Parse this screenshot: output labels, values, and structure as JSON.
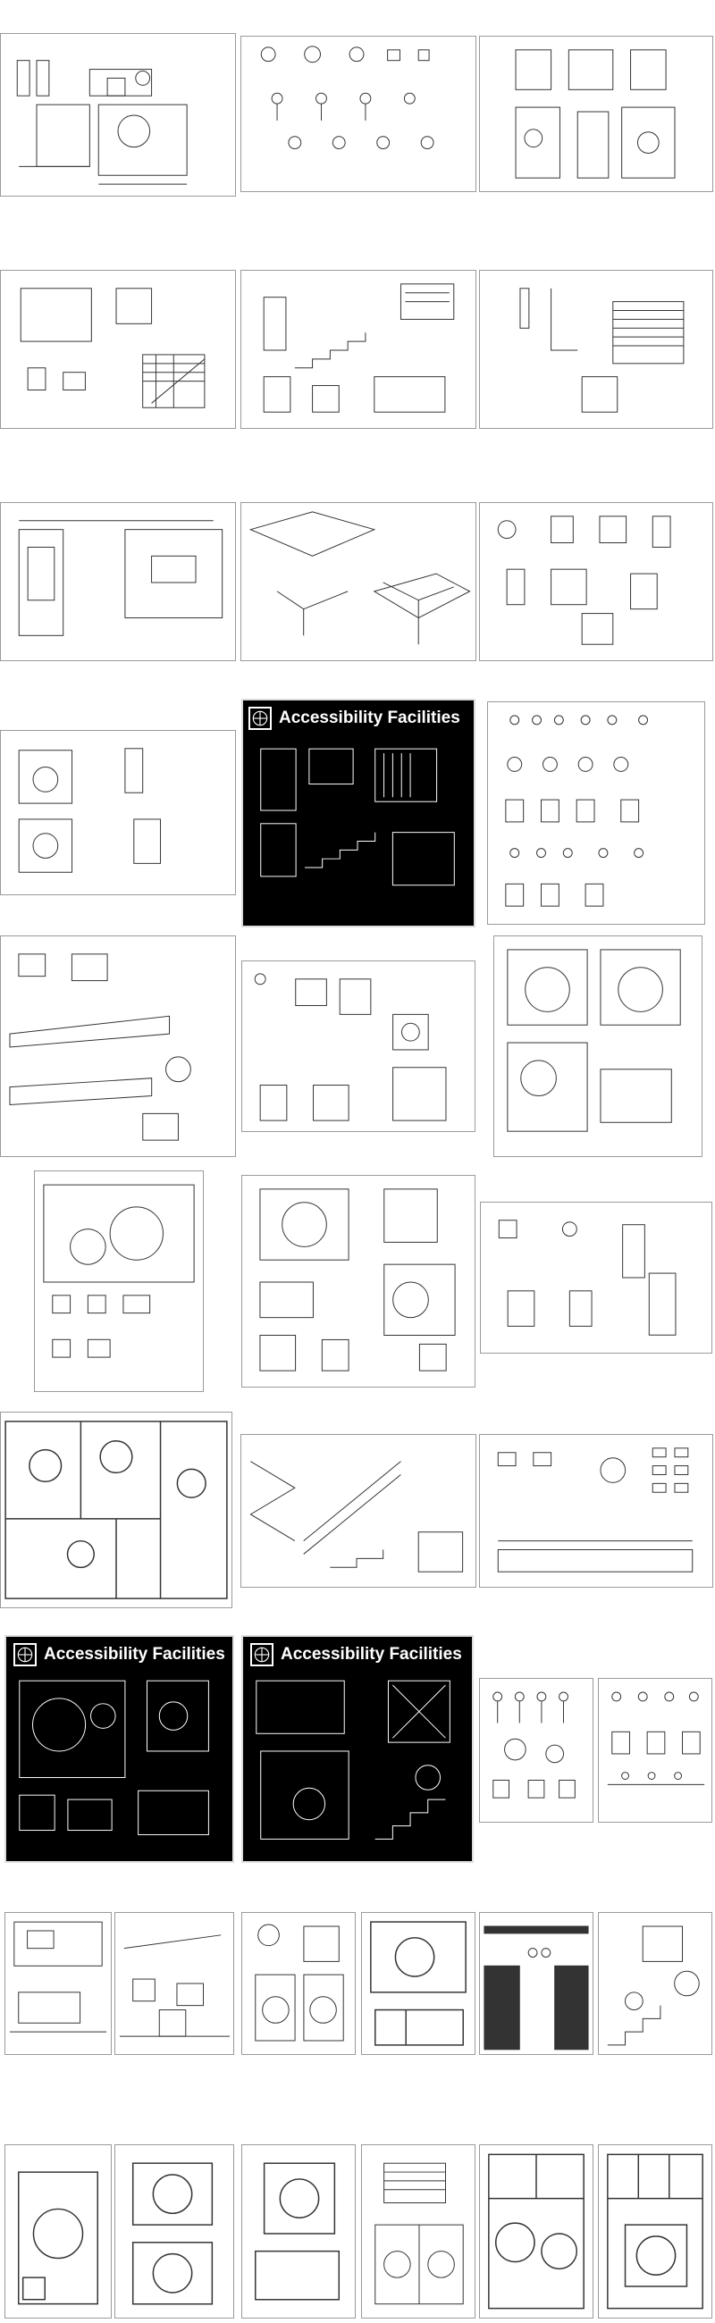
{
  "page": {
    "banner_title": "Accessibility Facilities",
    "icons": [
      "vitruvian-logo-icon"
    ]
  },
  "rows": [
    [
      "sheet-1",
      "sheet-2",
      "sheet-3"
    ],
    [
      "sheet-4",
      "sheet-5",
      "sheet-6"
    ],
    [
      "sheet-7",
      "sheet-8",
      "sheet-9"
    ],
    [
      "sheet-10",
      "sheet-11-dark",
      "sheet-12"
    ],
    [
      "sheet-13",
      "sheet-14",
      "sheet-15"
    ],
    [
      "sheet-16",
      "sheet-17",
      "sheet-18"
    ],
    [
      "sheet-19",
      "sheet-20",
      "sheet-21"
    ],
    [
      "sheet-22-dark",
      "sheet-23-dark",
      "sheet-24",
      "sheet-25"
    ],
    [
      "sheet-26",
      "sheet-27",
      "sheet-28",
      "sheet-29",
      "sheet-30",
      "sheet-31"
    ],
    [
      "sheet-32",
      "sheet-33",
      "sheet-34",
      "sheet-35",
      "sheet-36",
      "sheet-37"
    ]
  ]
}
